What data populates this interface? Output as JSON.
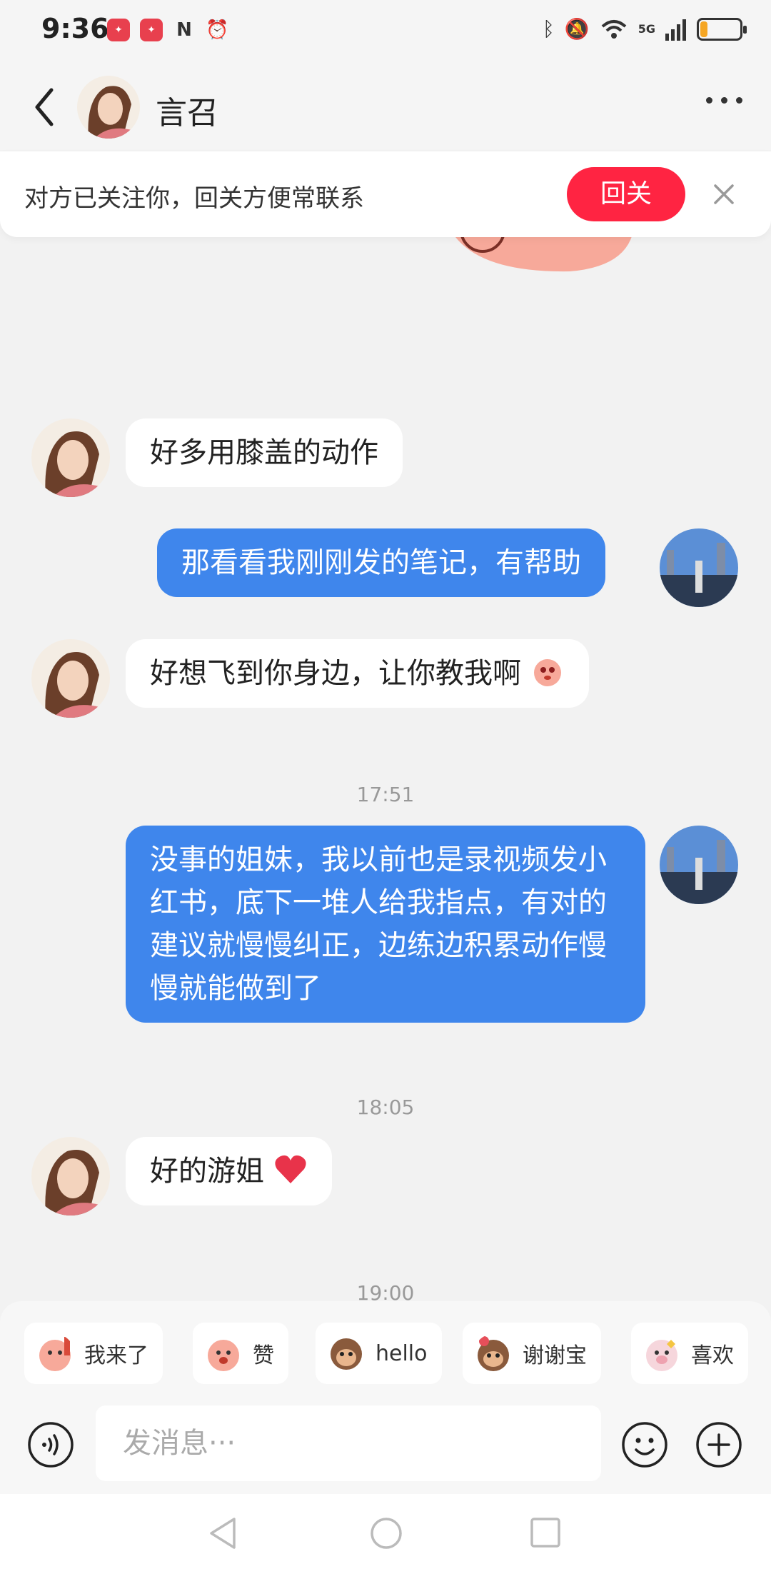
{
  "status_bar": {
    "time": "9:36",
    "left_icons": [
      "xiaohongshu-notification-icon",
      "xiaohongshu-notification-icon",
      "nfc-icon",
      "alarm-icon"
    ],
    "right_icons": [
      "bluetooth-icon",
      "mute-icon",
      "wifi-icon",
      "5g-signal-icon",
      "battery-icon"
    ],
    "network_label": "5G",
    "battery_level": 0.18,
    "battery_color": "#f5a623"
  },
  "header": {
    "contact_name": "言召"
  },
  "follow_banner": {
    "text": "对方已关注你，回关方便常联系",
    "button_label": "回关"
  },
  "messages": [
    {
      "side": "right",
      "type": "sticker",
      "sticker": "peach-phone-sticker"
    },
    {
      "side": "left",
      "type": "text",
      "text": "好多用膝盖的动作"
    },
    {
      "side": "right",
      "type": "text",
      "text": "那看看我刚刚发的笔记，有帮助"
    },
    {
      "side": "left",
      "type": "text",
      "text": "好想飞到你身边，让你教我啊",
      "emoji": "peach-emoji"
    },
    {
      "type": "timestamp",
      "text": "17:51"
    },
    {
      "side": "right",
      "type": "text",
      "text": "没事的姐妹，我以前也是录视频发小红书，底下一堆人给我指点，有对的建议就慢慢纠正，边练边积累动作慢慢就能做到了"
    },
    {
      "type": "timestamp",
      "text": "18:05"
    },
    {
      "side": "left",
      "type": "text",
      "text": "好的游姐",
      "emoji": "red-heart-emoji"
    },
    {
      "type": "timestamp",
      "text": "19:00"
    }
  ],
  "quick_replies": [
    {
      "label": "我来了",
      "icon": "peach-arrive-sticker"
    },
    {
      "label": "赞",
      "icon": "peach-like-sticker"
    },
    {
      "label": "hello",
      "icon": "monkey-hello-sticker"
    },
    {
      "label": "谢谢宝",
      "icon": "monkey-thanks-sticker"
    },
    {
      "label": "喜欢",
      "icon": "pig-love-sticker"
    }
  ],
  "input": {
    "placeholder": "发消息···"
  },
  "colors": {
    "accent_red": "#ff2442",
    "bubble_blue": "#3f86ec",
    "background": "#f2f2f2"
  }
}
